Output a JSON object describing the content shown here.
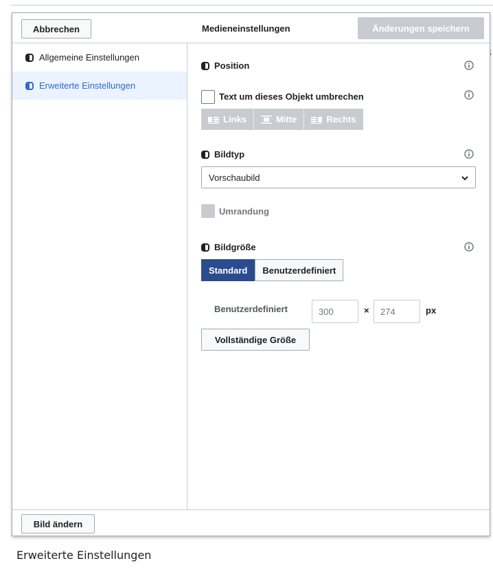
{
  "dialog": {
    "title": "Medieneinstellungen",
    "cancel_label": "Abbrechen",
    "save_label": "Änderungen speichern"
  },
  "sidebar": {
    "items": [
      {
        "label": "Allgemeine Einstellungen",
        "active": false
      },
      {
        "label": "Erweiterte Einstellungen",
        "active": true
      }
    ]
  },
  "panel": {
    "position": {
      "title": "Position",
      "wrap_label": "Text um dieses Objekt umbrechen",
      "wrap_checked": false,
      "align_buttons": [
        "Links",
        "Mitte",
        "Rechts"
      ]
    },
    "image_type": {
      "title": "Bildtyp",
      "selected": "Vorschaubild",
      "border_label": "Umrandung"
    },
    "image_size": {
      "title": "Bildgröße",
      "modes": [
        "Standard",
        "Benutzerdefiniert"
      ],
      "active_mode": "Standard",
      "custom_label": "Benutzerdefiniert",
      "width": "300",
      "height": "274",
      "times": "×",
      "unit": "px",
      "full_size_label": "Vollständige Größe"
    }
  },
  "footer": {
    "change_label": "Bild ändern"
  },
  "caption": "Erweiterte Einstellungen",
  "colors": {
    "accent": "#2a4b8d",
    "active_bg": "#eaf3ff",
    "link": "#3366cc",
    "disabled": "#c8ccd1"
  }
}
